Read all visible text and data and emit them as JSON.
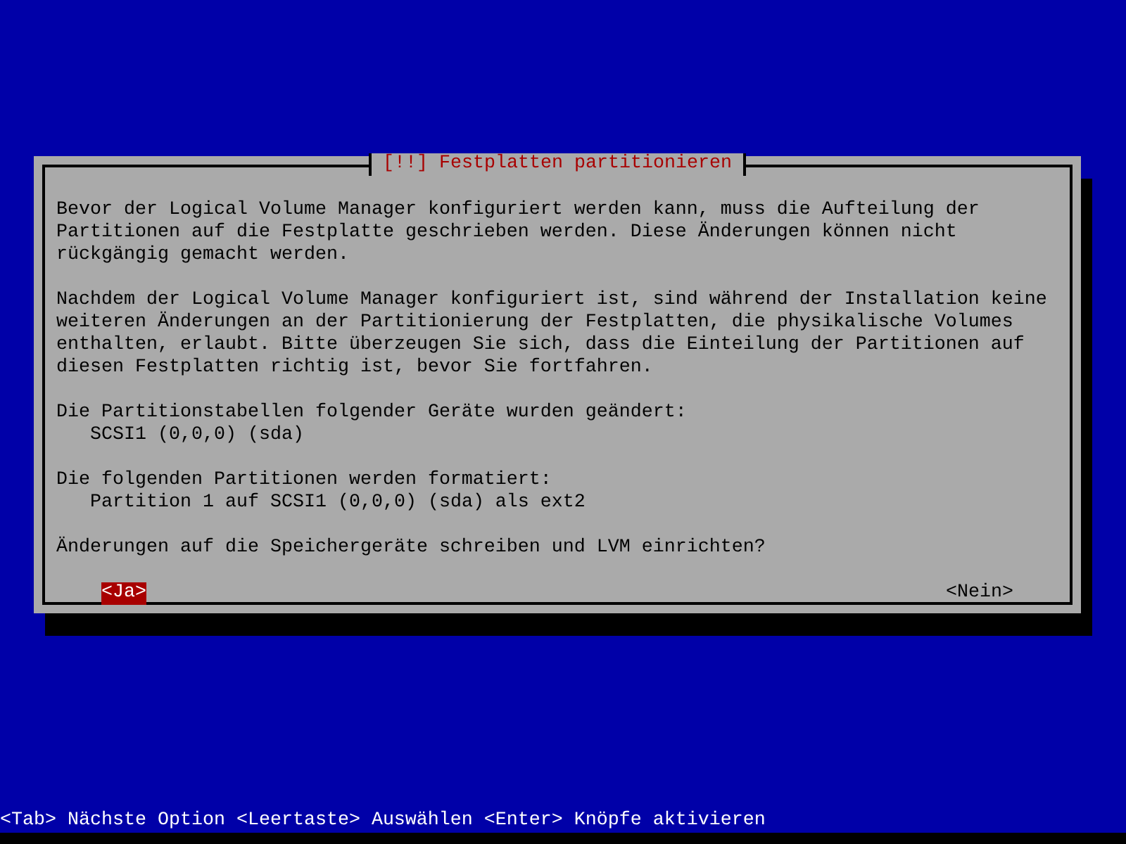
{
  "dialog": {
    "title": "[!!] Festplatten partitionieren",
    "paragraphs": [
      "Bevor der Logical Volume Manager konfiguriert werden kann, muss die Aufteilung der Partitionen auf die Festplatte geschrieben werden. Diese Änderungen können nicht rückgängig gemacht werden.",
      "Nachdem der Logical Volume Manager konfiguriert ist, sind während der Installation keine weiteren Änderungen an der Partitionierung der Festplatten, die physikalische Volumes enthalten, erlaubt. Bitte überzeugen Sie sich, dass die Einteilung der Partitionen auf diesen Festplatten richtig ist, bevor Sie fortfahren."
    ],
    "lists": [
      {
        "heading": "Die Partitionstabellen folgender Geräte wurden geändert:",
        "items": [
          "SCSI1 (0,0,0) (sda)"
        ]
      },
      {
        "heading": "Die folgenden Partitionen werden formatiert:",
        "items": [
          "Partition 1 auf SCSI1 (0,0,0) (sda) als ext2"
        ]
      }
    ],
    "question": "Änderungen auf die Speichergeräte schreiben und LVM einrichten?",
    "buttons": [
      {
        "label": "<Ja>",
        "selected": true
      },
      {
        "label": "<Nein>",
        "selected": false
      }
    ]
  },
  "status_bar": "<Tab> Nächste Option <Leertaste> Auswählen <Enter> Knöpfe aktivieren"
}
